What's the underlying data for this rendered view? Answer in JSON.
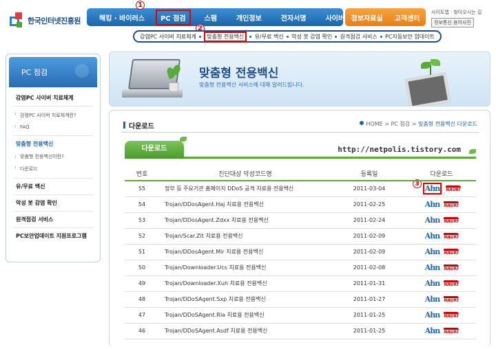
{
  "logo": {
    "text": "한국인터넷진흥원"
  },
  "gnb": {
    "items": [
      "해킹 · 바이러스",
      "PC 점검",
      "스팸",
      "개인정보",
      "전자서명",
      "사이버윤리"
    ],
    "extra": [
      "정보자료실",
      "고객센터"
    ]
  },
  "util": {
    "line1": "사이트맵 · 찾아오시는 길",
    "dict": "정보통신 용어사전"
  },
  "badges": {
    "one": "1",
    "two": "2",
    "three": "3"
  },
  "sub_gnb": [
    "감염PC 사이버 치료체계",
    "맞춤형 전용백신",
    "유/무료 백신",
    "악성 봇 감염 확인",
    "원격점검 서비스",
    "PC자동보안 업데이트"
  ],
  "lnb": {
    "title": "PC 점검",
    "items": [
      {
        "label": "감염PC 사이버 치료체계",
        "type": "main"
      },
      {
        "label": "감염PC 사이버 치료체계란?",
        "type": "sub-first"
      },
      {
        "label": "FAQ",
        "type": "sub-last"
      },
      {
        "label": "맞춤형 전용백신",
        "type": "current"
      },
      {
        "label": "맞춤형 전용백신이란?",
        "type": "sub-first"
      },
      {
        "label": "다운로드",
        "type": "sub-last"
      },
      {
        "label": "유/무료 백신",
        "type": "main"
      },
      {
        "label": "악성 봇 감염 확인",
        "type": "main"
      },
      {
        "label": "원격점검 서비스",
        "type": "main"
      },
      {
        "label": "PC보안업데이트 지원프로그램",
        "type": "main"
      }
    ]
  },
  "banner": {
    "title": "맞춤형 전용백신",
    "subtitle": "맞춤형 전용백신 서비스에 대해 알려드립니다."
  },
  "content": {
    "title": "다운로드",
    "breadcrumb": {
      "home": "HOME",
      "sep1": " > ",
      "mid": "PC 점검",
      "sep2": " > ",
      "current": "맞춤형 전용백신 다운로드"
    },
    "tab": "다운로드",
    "watermark": "http://netpolis.tistory.com"
  },
  "table": {
    "headers": [
      "번호",
      "진단대상 악성코드명",
      "등록일",
      "다운로드"
    ],
    "rows": [
      {
        "no": "55",
        "name": "정부 등 주요기관 홈페이지 DDoS 공격 치료용 전용백신",
        "date": "2011-03-04"
      },
      {
        "no": "54",
        "name": "Trojan/DDosAgent.Haj 치료용 전용백신",
        "date": "2011-02-25"
      },
      {
        "no": "53",
        "name": "Trojan/DDosAgent.Zdxx 치료용 전용백신",
        "date": "2011-02-24"
      },
      {
        "no": "52",
        "name": "Trojan/Scar.Zit 치료용 전용백신",
        "date": "2011-02-09"
      },
      {
        "no": "51",
        "name": "Trojan/DDosAgent.Mir 치료용 전용백신",
        "date": "2011-02-09"
      },
      {
        "no": "50",
        "name": "Trojan/Downloader.Ucs 치료용 전용백신",
        "date": "2011-02-08"
      },
      {
        "no": "49",
        "name": "Trojan/Downloader.Xuh 치료용 전용백신",
        "date": "2011-01-31"
      },
      {
        "no": "48",
        "name": "Trojan/DDoSAgent.Sxp 치료용 전용백신",
        "date": "2011-01-27"
      },
      {
        "no": "47",
        "name": "Trojan/DDoSAgent.Rla 치료용 전용백신",
        "date": "2011-01-25"
      },
      {
        "no": "46",
        "name": "Trojan/DDoSAgent.Asdf 치료용 전용백신",
        "date": "2011-01-25"
      }
    ],
    "vendor1": "Ahn",
    "vendor2": "NAURI"
  }
}
